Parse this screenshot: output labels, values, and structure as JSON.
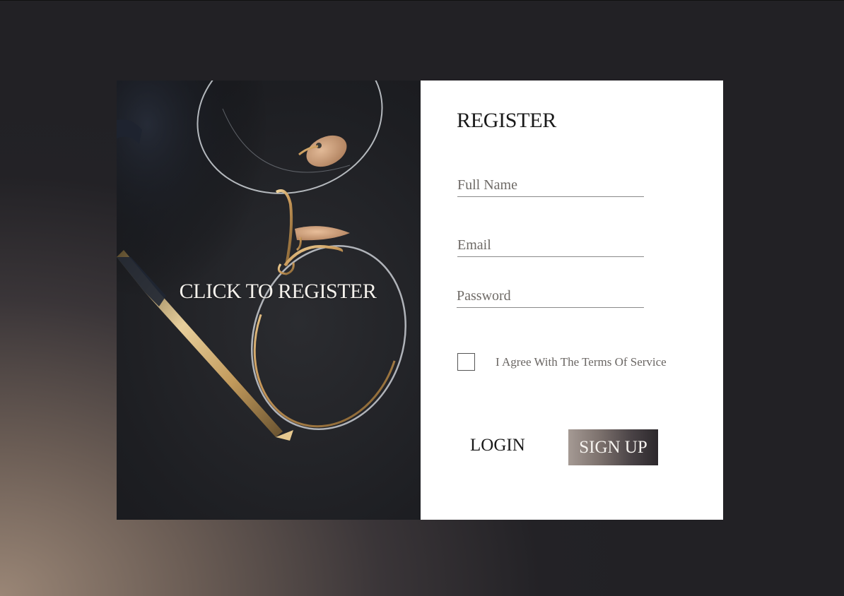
{
  "hero": {
    "cta_label": "CLICK TO REGISTER",
    "image_icon": "eyeglasses-photo"
  },
  "form": {
    "title": "REGISTER",
    "full_name_placeholder": "Full Name",
    "email_placeholder": "Email",
    "password_placeholder": "Password",
    "agree_label": "I Agree With The Terms Of Service",
    "agree_checked": false,
    "login_label": "LOGIN",
    "signup_label": "SIGN UP"
  },
  "colors": {
    "form_background": "#ffffff",
    "signup_gradient_start": "#a59a94",
    "signup_gradient_end": "#2c282c",
    "page_dark": "#232226",
    "page_warm": "#9a8676"
  }
}
